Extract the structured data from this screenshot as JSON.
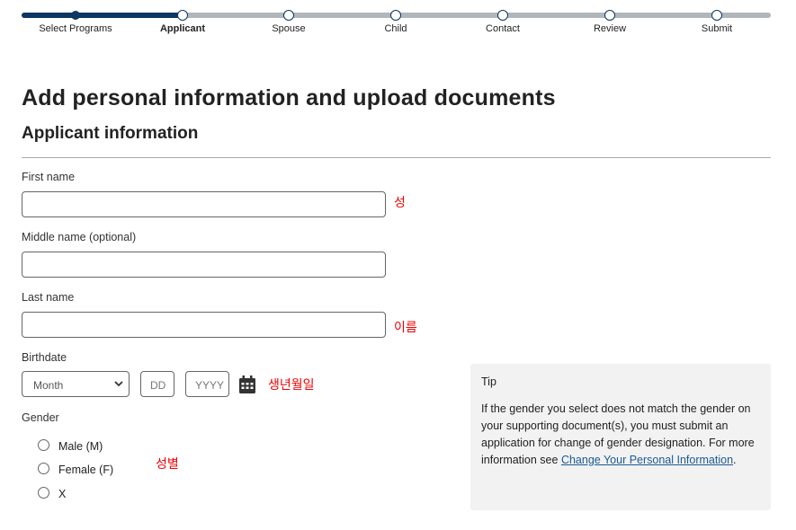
{
  "progress": {
    "steps": [
      {
        "label": "Select Programs",
        "state": "done"
      },
      {
        "label": "Applicant",
        "state": "current"
      },
      {
        "label": "Spouse",
        "state": "todo"
      },
      {
        "label": "Child",
        "state": "todo"
      },
      {
        "label": "Contact",
        "state": "todo"
      },
      {
        "label": "Review",
        "state": "todo"
      },
      {
        "label": "Submit",
        "state": "todo"
      }
    ]
  },
  "page_title": "Add personal information and upload documents",
  "section_title": "Applicant information",
  "fields": {
    "first_name": {
      "label": "First name",
      "value": "",
      "annotation": "성"
    },
    "middle_name": {
      "label": "Middle name (optional)",
      "value": ""
    },
    "last_name": {
      "label": "Last name",
      "value": "",
      "annotation": "이름"
    },
    "birthdate": {
      "label": "Birthdate",
      "month": "Month",
      "day_placeholder": "DD",
      "year_placeholder": "YYYY",
      "annotation": "생년월일"
    },
    "gender": {
      "label": "Gender",
      "options": [
        "Male (M)",
        "Female (F)",
        "X"
      ],
      "annotation": "성별"
    }
  },
  "tip": {
    "title": "Tip",
    "text": "If the gender you select does not match the gender on your supporting document(s), you must submit an application for change of gender designation. For more information see ",
    "link": "Change Your Personal Information",
    "after": "."
  },
  "colors": {
    "primary": "#0c3663",
    "annotation": "#ee0000",
    "link": "#1a5a96"
  }
}
